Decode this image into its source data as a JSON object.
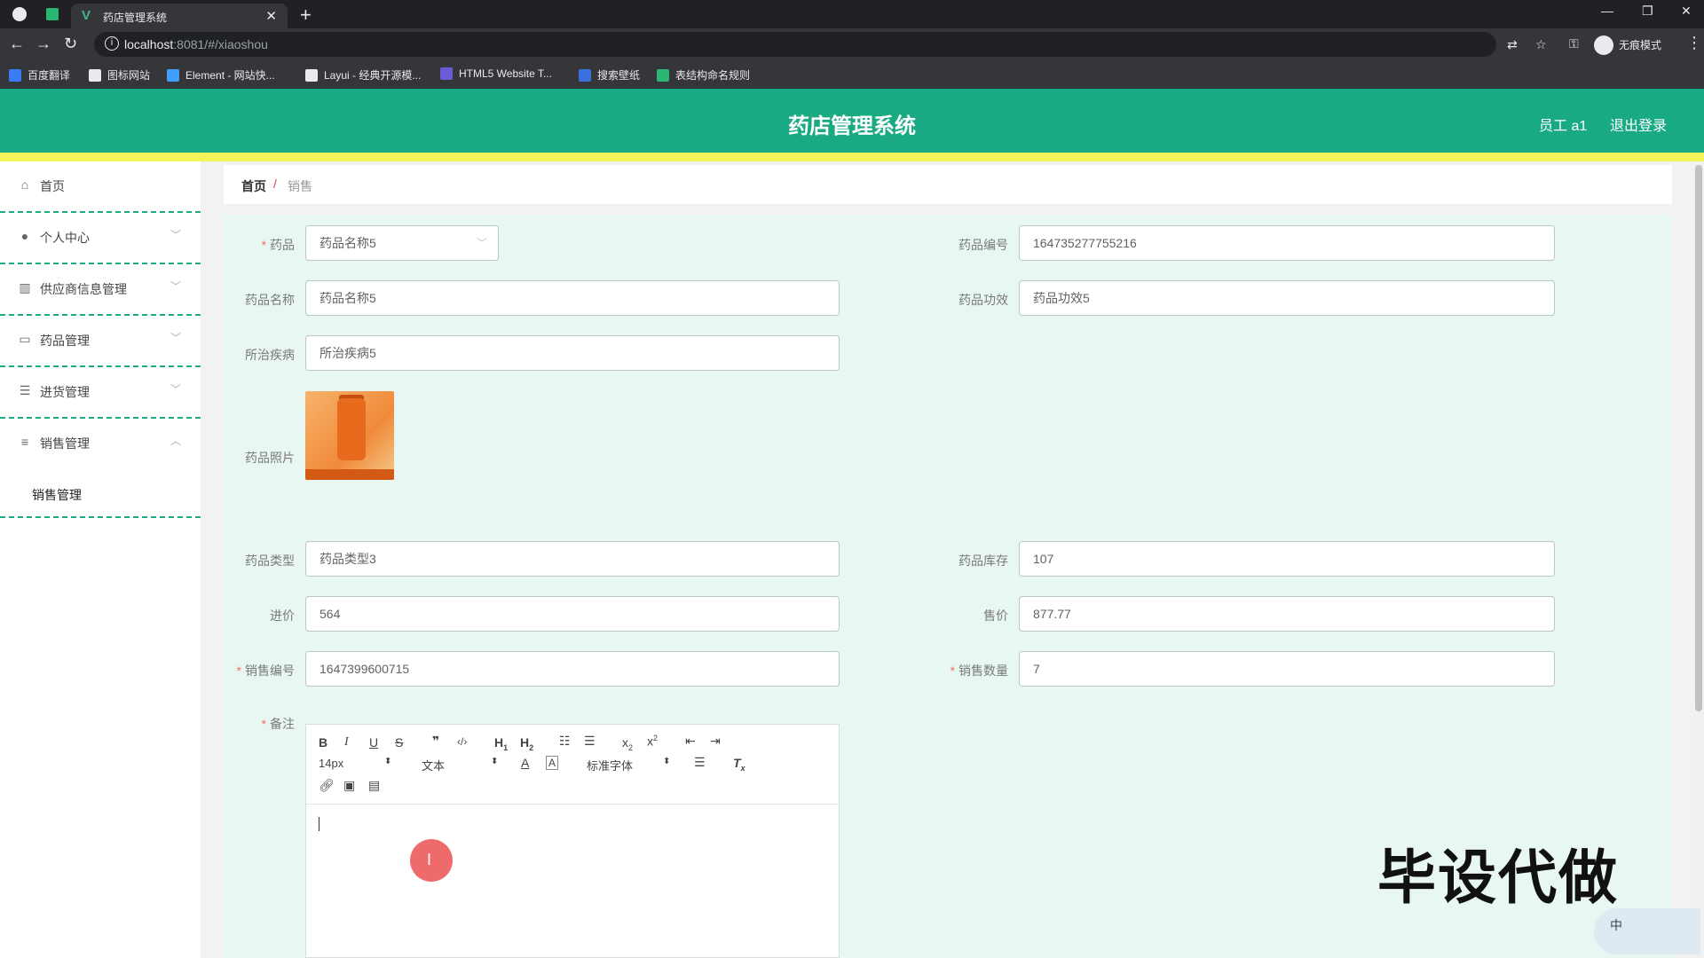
{
  "browser": {
    "tab_title": "药店管理系统",
    "tab_favicon": "V",
    "url_host": "localhost",
    "url_rest": ":8081/#/xiaoshou",
    "incognito_label": "无痕模式",
    "bookmarks": [
      {
        "label": "百度翻译",
        "color": "#3b7cf6"
      },
      {
        "label": "图标网站",
        "color": "#e8eaed"
      },
      {
        "label": "Element - 网站快...",
        "color": "#409eff"
      },
      {
        "label": "Layui - 经典开源模...",
        "color": "#e8eaed"
      },
      {
        "label": "HTML5 Website T...",
        "color": "#6b5bd6"
      },
      {
        "label": "搜索壁纸",
        "color": "#3b6fe0"
      },
      {
        "label": "表结构命名规则",
        "color": "#2bb673"
      }
    ]
  },
  "header": {
    "title": "药店管理系统",
    "user": "员工 a1",
    "logout": "退出登录",
    "brand_color": "#1aaa83"
  },
  "sidebar": {
    "items": [
      {
        "label": "首页",
        "icon": "home-icon",
        "arrow": ""
      },
      {
        "label": "个人中心",
        "icon": "user-icon",
        "arrow": "﹀"
      },
      {
        "label": "供应商信息管理",
        "icon": "chart-icon",
        "arrow": "﹀"
      },
      {
        "label": "药品管理",
        "icon": "monitor-icon",
        "arrow": "﹀"
      },
      {
        "label": "进货管理",
        "icon": "list-icon",
        "arrow": "﹀"
      },
      {
        "label": "销售管理",
        "icon": "sliders-icon",
        "arrow": "︿"
      }
    ],
    "sub_item": "销售管理"
  },
  "breadcrumb": {
    "home": "首页",
    "separator": "/",
    "current": "销售"
  },
  "form": {
    "drug_label": "药品",
    "drug_value": "药品名称5",
    "code_label": "药品编号",
    "code_value": "164735277755216",
    "name_label": "药品名称",
    "name_value": "药品名称5",
    "effect_label": "药品功效",
    "effect_value": "药品功效5",
    "disease_label": "所治疾病",
    "disease_value": "所治疾病5",
    "photo_label": "药品照片",
    "type_label": "药品类型",
    "type_value": "药品类型3",
    "stock_label": "药品库存",
    "stock_value": "107",
    "cost_label": "进价",
    "cost_value": "564",
    "price_label": "售价",
    "price_value": "877.77",
    "sale_no_label": "销售编号",
    "sale_no_value": "1647399600715",
    "qty_label": "销售数量",
    "qty_value": "7",
    "remark_label": "备注",
    "required_mark": "*"
  },
  "editor": {
    "font_size": "14px",
    "block_type": "文本",
    "font_family": "标准字体"
  },
  "watermark": "毕设代做",
  "ime": "中"
}
